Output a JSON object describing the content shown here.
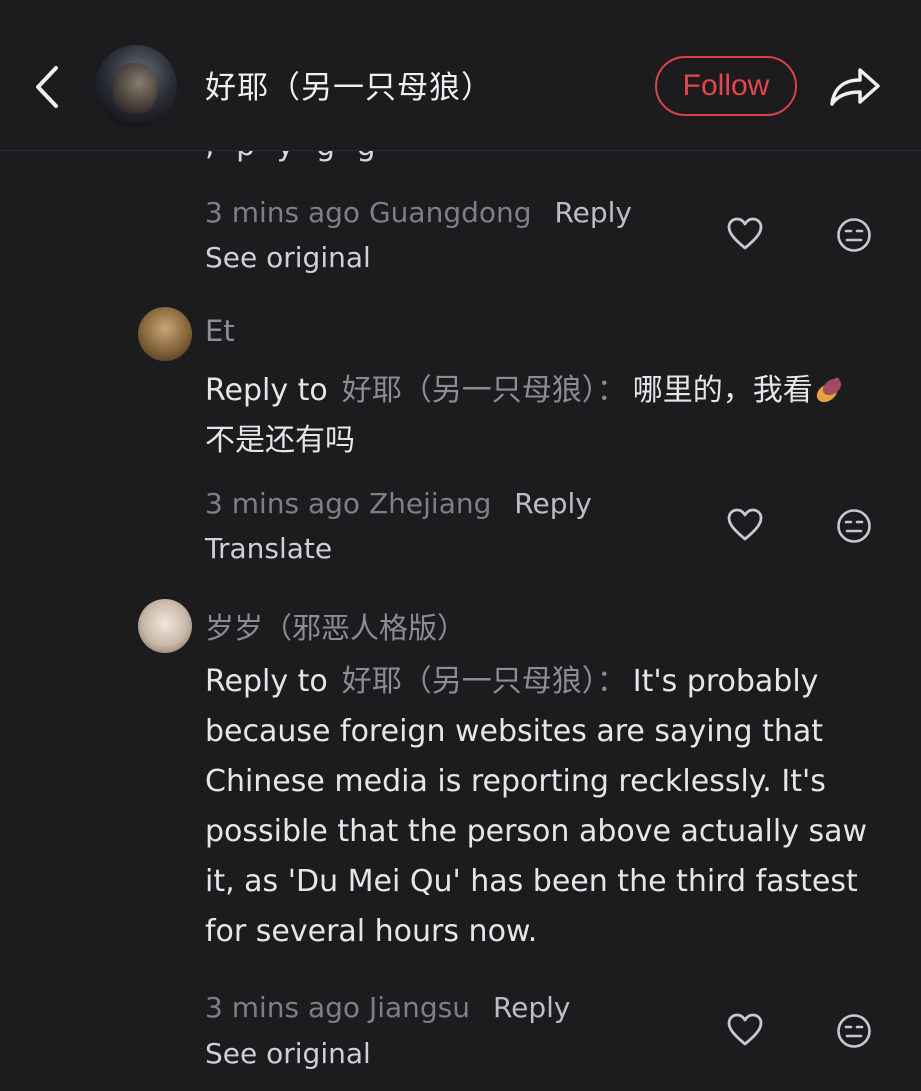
{
  "header": {
    "back_icon": "chevron-left-icon",
    "name": "好耶（另一只母狼）",
    "follow_label": "Follow",
    "share_icon": "share-arrow-icon",
    "accent_color": "#e2474e"
  },
  "comments": [
    {
      "partial_text": ", p          y  g  g",
      "time": "3 mins ago",
      "location": "Guangdong",
      "reply_label": "Reply",
      "action": "See original"
    },
    {
      "author": "Et",
      "reply_to_label": "Reply to",
      "reply_to_name": "好耶（另一只母狼）：",
      "text_line1": "哪里的，我看",
      "emoji": "sweet-potato-emoji",
      "text_line2": "不是还有吗",
      "time": "3 mins ago",
      "location": "Zhejiang",
      "reply_label": "Reply",
      "action": "Translate"
    },
    {
      "author": "岁岁（邪恶人格版）",
      "reply_to_label": "Reply to",
      "reply_to_name": "好耶（另一只母狼）：",
      "text": "It's probably because foreign websites are saying that Chinese media is reporting recklessly. It's possible that the person above actually saw it, as 'Du Mei Qu' has been the third fastest for several hours now.",
      "time": "3 mins ago",
      "location": "Jiangsu",
      "reply_label": "Reply",
      "action": "See original"
    }
  ]
}
